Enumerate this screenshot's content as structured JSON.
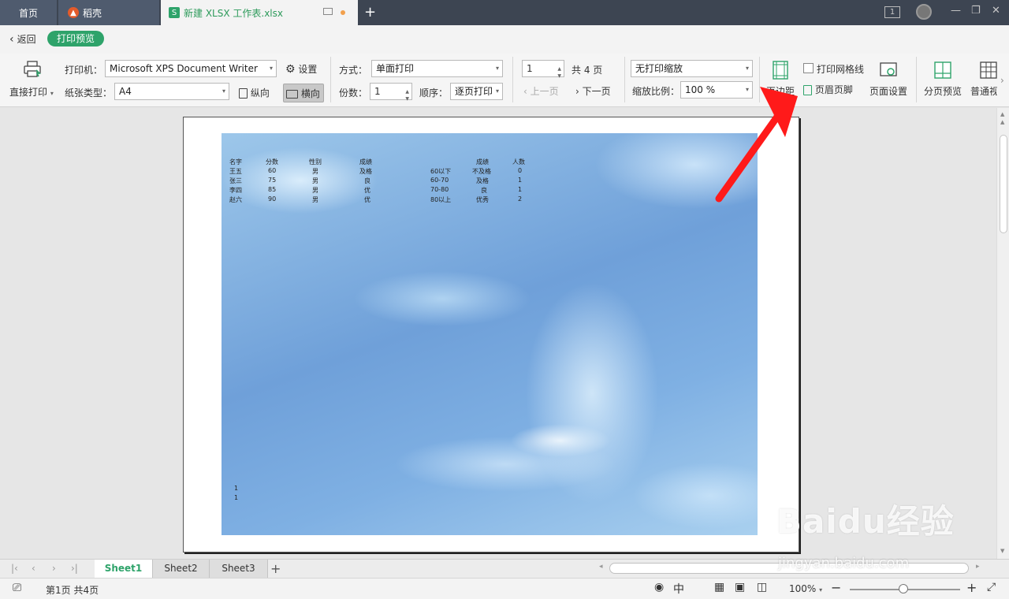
{
  "tabs": {
    "home": "首页",
    "daoke": "稻壳",
    "file": "新建 XLSX 工作表.xlsx",
    "window_count": "1"
  },
  "subbar": {
    "back": "返回",
    "mode_badge": "打印预览"
  },
  "ribbon": {
    "direct_print": "直接打印",
    "printer_label": "打印机：",
    "printer_value": "Microsoft XPS Document Writer",
    "settings": "设置",
    "paper_label": "纸张类型：",
    "paper_value": "A4",
    "portrait": "纵向",
    "landscape": "横向",
    "method_label": "方式：",
    "method_value": "单面打印",
    "copies_label": "份数：",
    "copies_value": "1",
    "order_label": "顺序：",
    "order_value": "逐页打印",
    "page_value": "1",
    "total_pages": "共 4 页",
    "prev_page": "上一页",
    "next_page": "下一页",
    "scale_mode": "无打印缩放",
    "scale_label": "缩放比例：",
    "scale_value": "100 %",
    "margins": "页边距",
    "print_gridlines": "打印网格线",
    "header_footer": "页眉页脚",
    "page_setup": "页面设置",
    "page_break_preview": "分页预览",
    "normal_view": "普通视"
  },
  "sheet": {
    "table1_headers": [
      "名字",
      "分数",
      "性别",
      "成绩"
    ],
    "table1_rows": [
      [
        "王五",
        "60",
        "男",
        "及格"
      ],
      [
        "张三",
        "75",
        "男",
        "良"
      ],
      [
        "李四",
        "85",
        "男",
        "优"
      ],
      [
        "赵六",
        "90",
        "男",
        "优"
      ]
    ],
    "table2_headers": [
      "成绩",
      "人数"
    ],
    "table2_rows": [
      [
        "60以下",
        "不及格",
        "0"
      ],
      [
        "60-70",
        "及格",
        "1"
      ],
      [
        "70-80",
        "良",
        "1"
      ],
      [
        "80以上",
        "优秀",
        "2"
      ]
    ],
    "footer_line1": "1",
    "footer_line2": "1"
  },
  "sheet_tabs": [
    "Sheet1",
    "Sheet2",
    "Sheet3"
  ],
  "status": {
    "page_info": "第1页 共4页",
    "zoom": "100%"
  },
  "watermark": {
    "logo": "Baidu经验",
    "url": "jingyan.baidu.com"
  },
  "colors": {
    "accent": "#2ea36a",
    "arrow": "#ff1a1a"
  }
}
